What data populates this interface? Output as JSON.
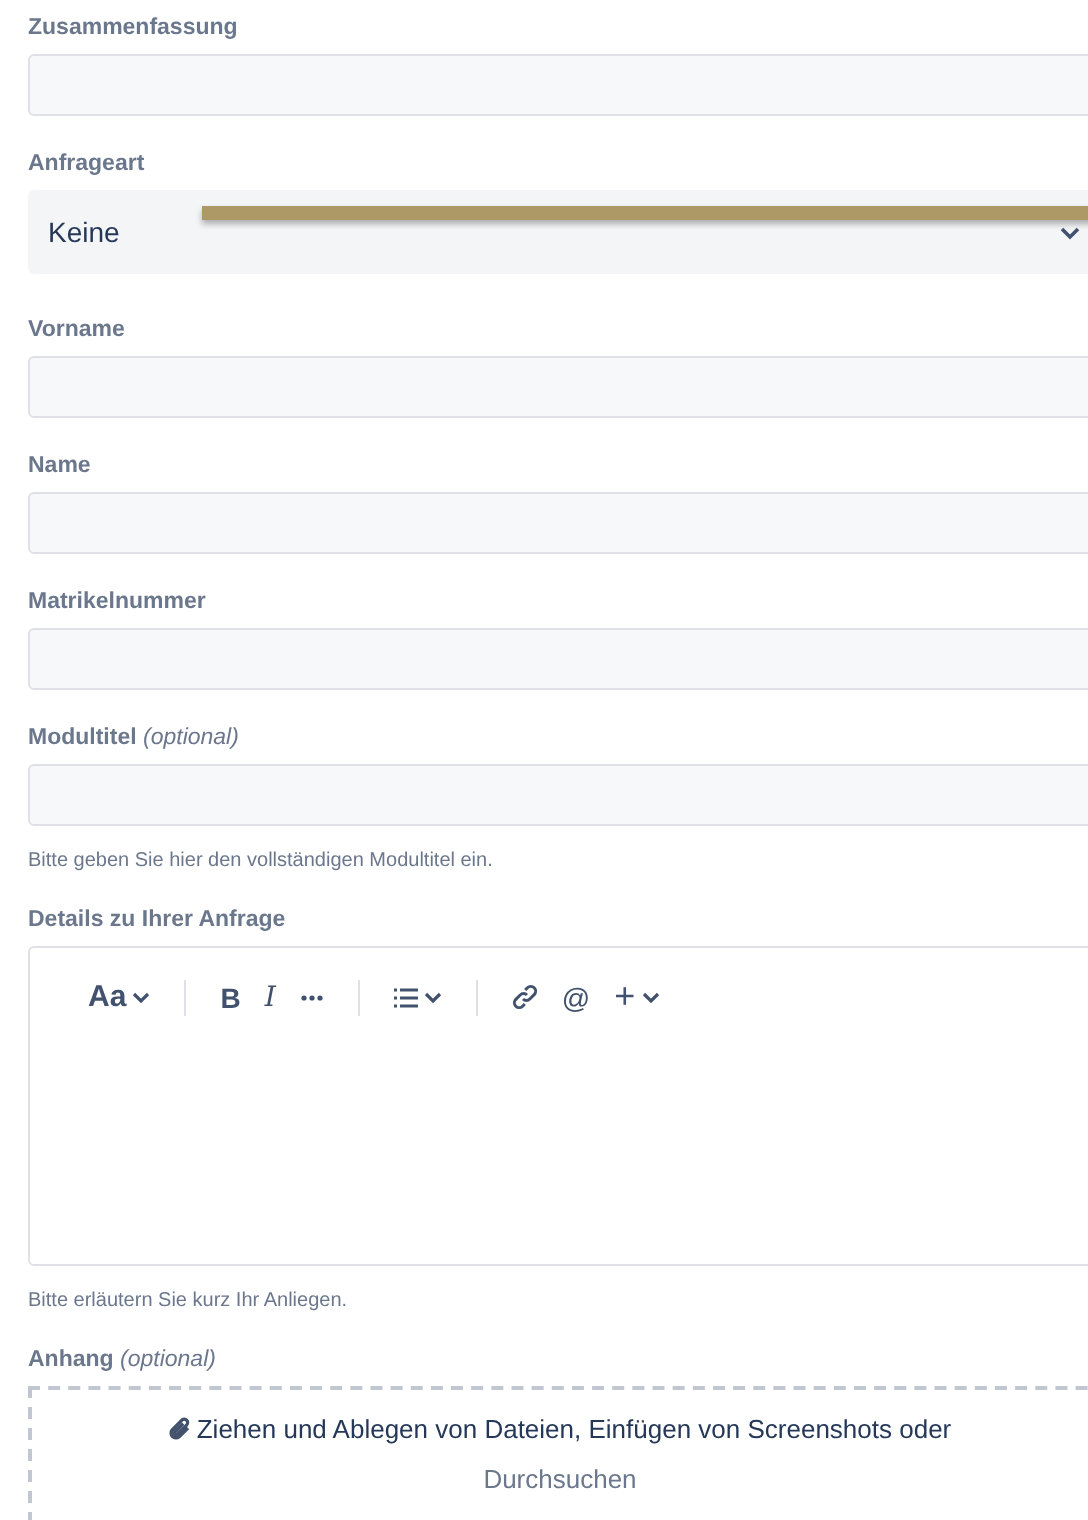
{
  "fields": [
    {
      "kind": "text",
      "label": "Zusammenfassung"
    },
    {
      "kind": "select",
      "label": "Anfrageart",
      "value": "Keine"
    },
    {
      "kind": "text",
      "label": "Vorname"
    },
    {
      "kind": "text",
      "label": "Name"
    },
    {
      "kind": "text",
      "label": "Matrikelnummer"
    },
    {
      "kind": "text",
      "label": "Modultitel",
      "optional": "(optional)",
      "help": "Bitte geben Sie hier den vollständigen Modultitel ein."
    },
    {
      "kind": "editor",
      "label": "Details zu Ihrer Anfrage",
      "help": "Bitte erläutern Sie kurz Ihr Anliegen.",
      "toolbar": [
        {
          "kind": "style-menu",
          "text": "Aa"
        },
        {
          "kind": "divider"
        },
        {
          "kind": "bold",
          "text": "B"
        },
        {
          "kind": "italic",
          "text": "I"
        },
        {
          "kind": "more"
        },
        {
          "kind": "divider"
        },
        {
          "kind": "list"
        },
        {
          "kind": "divider"
        },
        {
          "kind": "link"
        },
        {
          "kind": "mention",
          "text": "@"
        },
        {
          "kind": "insert",
          "text": "+"
        }
      ]
    },
    {
      "kind": "attachment",
      "label": "Anhang",
      "optional": "(optional)",
      "prompt": "Ziehen und Ablegen von Dateien, Einfügen von Screenshots oder",
      "browse": "Durchsuchen"
    }
  ]
}
